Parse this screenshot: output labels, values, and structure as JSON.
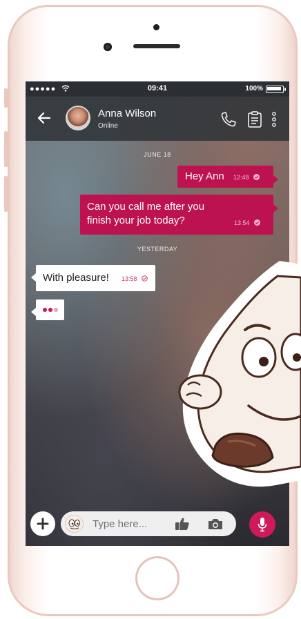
{
  "status_bar": {
    "signal": "●●●●●",
    "time": "09:41",
    "battery": "100%"
  },
  "header": {
    "name": "Anna Wilson",
    "status": "Online"
  },
  "messages": [
    {
      "type": "date",
      "text": "JUNE 18"
    },
    {
      "type": "out",
      "text": "Hey Ann",
      "time": "12:48"
    },
    {
      "type": "out",
      "lines": [
        "Can you call me after you",
        "finish your job today?"
      ],
      "time": "13:54"
    },
    {
      "type": "date",
      "text": "YESTERDAY"
    },
    {
      "type": "in",
      "text": "With pleasure!",
      "time": "13:58"
    }
  ],
  "input": {
    "placeholder": "Type here..."
  },
  "colors": {
    "accent": "#bd1250",
    "mic": "#cf1a5a",
    "header": "#303438"
  },
  "icons": [
    "back-arrow-icon",
    "phone-icon",
    "clipboard-icon",
    "more-vertical-icon",
    "plus-icon",
    "sticker-icon",
    "thumbs-up-icon",
    "camera-icon",
    "mic-icon",
    "read-check-icon"
  ]
}
